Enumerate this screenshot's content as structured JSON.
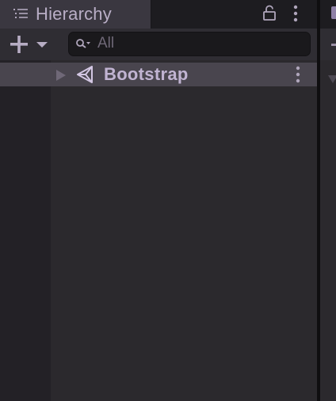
{
  "hierarchy": {
    "tab_title": "Hierarchy",
    "tab_icon": "list-icon",
    "lock_icon": "lock-icon",
    "menu_icon": "kebab-menu-icon"
  },
  "toolbar": {
    "add_icon": "plus-icon",
    "dropdown_icon": "caret-down-icon",
    "search": {
      "icon": "search-icon",
      "placeholder": "All",
      "value": ""
    }
  },
  "tree": {
    "items": [
      {
        "label": "Bootstrap",
        "icon": "unity-scene-icon",
        "expanded": false,
        "selected": true
      }
    ]
  },
  "colors": {
    "panel_bg": "#2b292d",
    "tab_bg": "#3a3740",
    "selected_row_bg": "#49454e",
    "text_accent": "#c1b4d2",
    "search_bg": "#1a191c"
  }
}
